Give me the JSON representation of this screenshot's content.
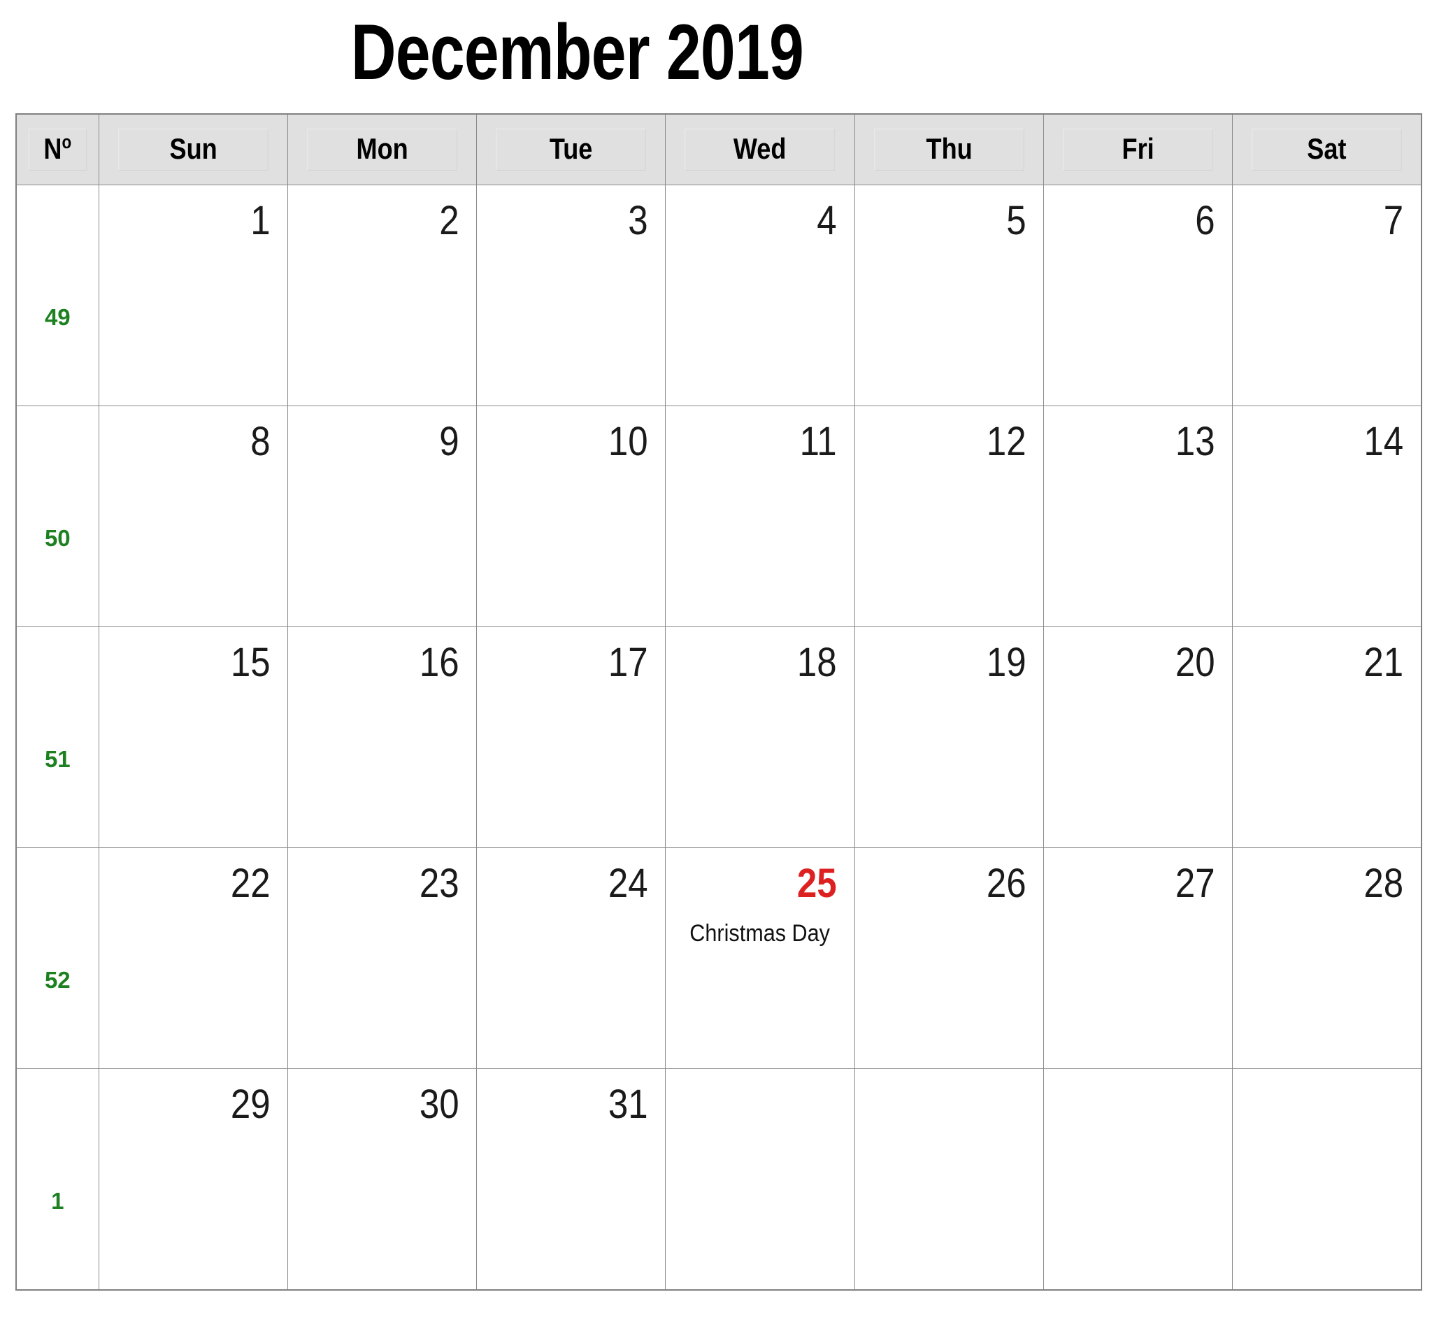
{
  "title": "December 2019",
  "colors": {
    "week_number": "#1d8021",
    "holiday": "#dd2020",
    "header_bg": "#e0e0e0",
    "grid_line": "#8a8a8a",
    "text": "#1a1a1a"
  },
  "header": {
    "week_col_label": "Nº",
    "week_col_label_base": "N",
    "week_col_label_sup": "o",
    "days": [
      "Sun",
      "Mon",
      "Tue",
      "Wed",
      "Thu",
      "Fri",
      "Sat"
    ]
  },
  "weeks": [
    {
      "number": "49",
      "days": [
        {
          "date": "1",
          "event": "",
          "holiday": false
        },
        {
          "date": "2",
          "event": "",
          "holiday": false
        },
        {
          "date": "3",
          "event": "",
          "holiday": false
        },
        {
          "date": "4",
          "event": "",
          "holiday": false
        },
        {
          "date": "5",
          "event": "",
          "holiday": false
        },
        {
          "date": "6",
          "event": "",
          "holiday": false
        },
        {
          "date": "7",
          "event": "",
          "holiday": false
        }
      ]
    },
    {
      "number": "50",
      "days": [
        {
          "date": "8",
          "event": "",
          "holiday": false
        },
        {
          "date": "9",
          "event": "",
          "holiday": false
        },
        {
          "date": "10",
          "event": "",
          "holiday": false
        },
        {
          "date": "11",
          "event": "",
          "holiday": false
        },
        {
          "date": "12",
          "event": "",
          "holiday": false
        },
        {
          "date": "13",
          "event": "",
          "holiday": false
        },
        {
          "date": "14",
          "event": "",
          "holiday": false
        }
      ]
    },
    {
      "number": "51",
      "days": [
        {
          "date": "15",
          "event": "",
          "holiday": false
        },
        {
          "date": "16",
          "event": "",
          "holiday": false
        },
        {
          "date": "17",
          "event": "",
          "holiday": false
        },
        {
          "date": "18",
          "event": "",
          "holiday": false
        },
        {
          "date": "19",
          "event": "",
          "holiday": false
        },
        {
          "date": "20",
          "event": "",
          "holiday": false
        },
        {
          "date": "21",
          "event": "",
          "holiday": false
        }
      ]
    },
    {
      "number": "52",
      "days": [
        {
          "date": "22",
          "event": "",
          "holiday": false
        },
        {
          "date": "23",
          "event": "",
          "holiday": false
        },
        {
          "date": "24",
          "event": "",
          "holiday": false
        },
        {
          "date": "25",
          "event": "Christmas  Day",
          "holiday": true
        },
        {
          "date": "26",
          "event": "",
          "holiday": false
        },
        {
          "date": "27",
          "event": "",
          "holiday": false
        },
        {
          "date": "28",
          "event": "",
          "holiday": false
        }
      ]
    },
    {
      "number": "1",
      "days": [
        {
          "date": "29",
          "event": "",
          "holiday": false
        },
        {
          "date": "30",
          "event": "",
          "holiday": false
        },
        {
          "date": "31",
          "event": "",
          "holiday": false
        },
        {
          "date": "",
          "event": "",
          "holiday": false
        },
        {
          "date": "",
          "event": "",
          "holiday": false
        },
        {
          "date": "",
          "event": "",
          "holiday": false
        },
        {
          "date": "",
          "event": "",
          "holiday": false
        }
      ]
    }
  ]
}
